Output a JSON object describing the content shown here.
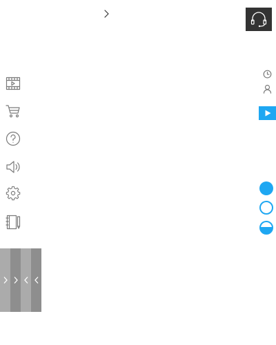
{
  "top_bar": {
    "forward_icon": "chevron-right",
    "support_icon": "headset"
  },
  "sidebar": {
    "items": [
      {
        "icon": "film-icon"
      },
      {
        "icon": "cart-icon"
      },
      {
        "icon": "help-icon"
      },
      {
        "icon": "speaker-icon"
      },
      {
        "icon": "gear-icon"
      },
      {
        "icon": "notebook-icon"
      }
    ]
  },
  "right_controls": {
    "icons": [
      "clock-icon",
      "user-icon",
      "play-icon"
    ],
    "indicators": [
      "filled",
      "empty",
      "half"
    ],
    "accent_color": "#1ea7f2"
  },
  "nav_strip": {
    "arrows": [
      "right",
      "right",
      "left",
      "left"
    ],
    "colors": [
      "#ababab",
      "#8e8e8e",
      "#ababab",
      "#8e8e8e"
    ]
  }
}
